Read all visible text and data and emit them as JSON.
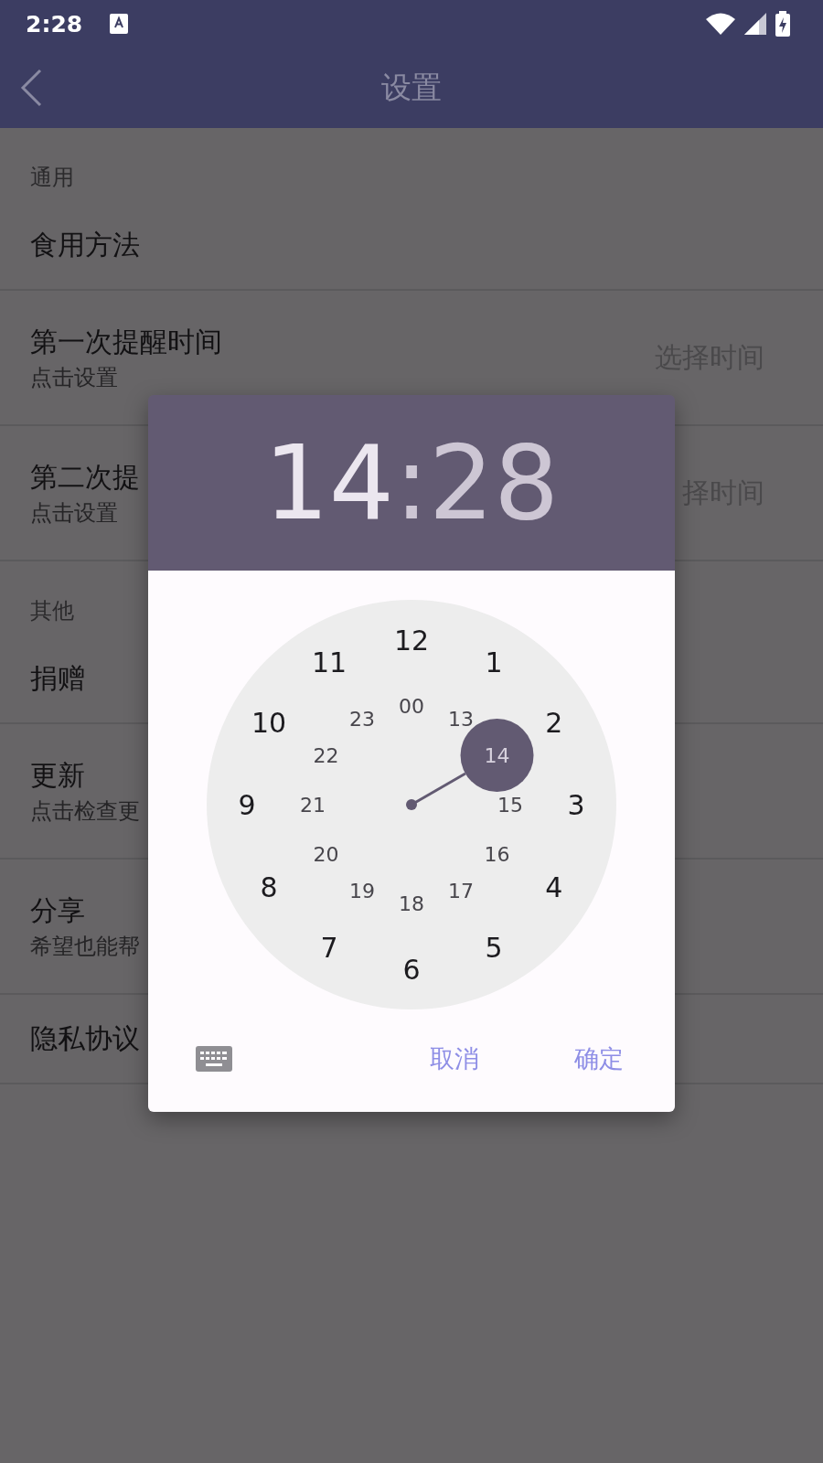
{
  "status_bar": {
    "time": "2:28"
  },
  "app_bar": {
    "title": "设置"
  },
  "sections": [
    {
      "header": "通用",
      "items": [
        {
          "title": "食用方法"
        },
        {
          "title": "第一次提醒时间",
          "subtitle": "点击设置",
          "value": "选择时间"
        },
        {
          "title": "第二次提",
          "subtitle": "点击设置",
          "value": "择时间"
        }
      ]
    },
    {
      "header": "其他",
      "items": [
        {
          "title": "捐赠"
        },
        {
          "title": "更新",
          "subtitle": "点击检查更"
        },
        {
          "title": "分享",
          "subtitle": "希望也能帮"
        },
        {
          "title": "隐私协议"
        }
      ]
    }
  ],
  "dialog": {
    "hour": {
      "text": "14",
      "selected": true
    },
    "separator": ":",
    "minute": {
      "text": "28",
      "selected": false
    },
    "outer_hours": [
      {
        "label": "12",
        "selected": false
      },
      {
        "label": "1",
        "selected": false
      },
      {
        "label": "2",
        "selected": false
      },
      {
        "label": "3",
        "selected": false
      },
      {
        "label": "4",
        "selected": false
      },
      {
        "label": "5",
        "selected": false
      },
      {
        "label": "6",
        "selected": false
      },
      {
        "label": "7",
        "selected": false
      },
      {
        "label": "8",
        "selected": false
      },
      {
        "label": "9",
        "selected": false
      },
      {
        "label": "10",
        "selected": false
      },
      {
        "label": "11",
        "selected": false
      }
    ],
    "inner_hours": [
      {
        "label": "00",
        "selected": false
      },
      {
        "label": "13",
        "selected": false
      },
      {
        "label": "14",
        "selected": true
      },
      {
        "label": "15",
        "selected": false
      },
      {
        "label": "16",
        "selected": false
      },
      {
        "label": "17",
        "selected": false
      },
      {
        "label": "18",
        "selected": false
      },
      {
        "label": "19",
        "selected": false
      },
      {
        "label": "20",
        "selected": false
      },
      {
        "label": "21",
        "selected": false
      },
      {
        "label": "22",
        "selected": false
      },
      {
        "label": "23",
        "selected": false
      }
    ],
    "buttons": [
      "取消",
      "确定"
    ]
  }
}
